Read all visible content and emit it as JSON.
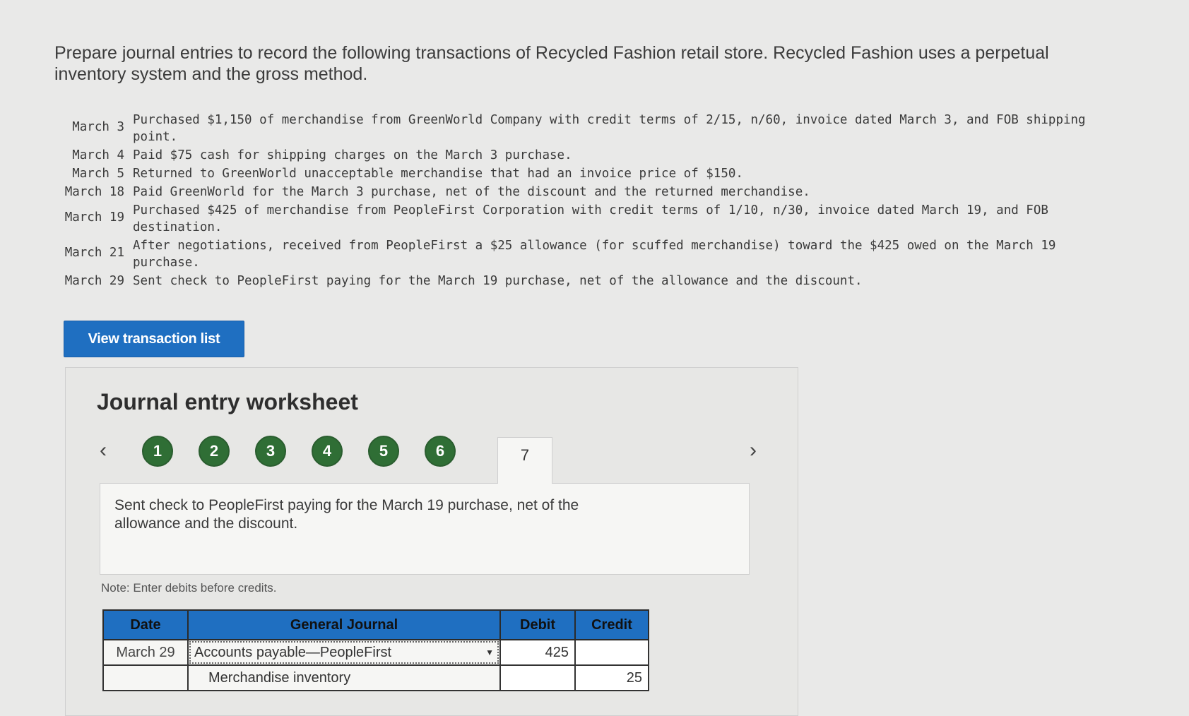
{
  "instructions": "Prepare journal entries to record the following transactions of Recycled Fashion retail store. Recycled Fashion uses a perpetual inventory system and the gross method.",
  "transactions": [
    {
      "date": "March 3",
      "text": "Purchased $1,150 of merchandise from GreenWorld Company with credit terms of 2/15, n/60, invoice dated March 3, and FOB shipping point."
    },
    {
      "date": "March 4",
      "text": "Paid $75 cash for shipping charges on the March 3 purchase."
    },
    {
      "date": "March 5",
      "text": "Returned to GreenWorld unacceptable merchandise that had an invoice price of $150."
    },
    {
      "date": "March 18",
      "text": "Paid GreenWorld for the March 3 purchase, net of the discount and the returned merchandise."
    },
    {
      "date": "March 19",
      "text": "Purchased $425 of merchandise from PeopleFirst Corporation with credit terms of 1/10, n/30, invoice dated March 19, and FOB destination."
    },
    {
      "date": "March 21",
      "text": "After negotiations, received from PeopleFirst a $25 allowance (for scuffed merchandise) toward the $425 owed on the March 19 purchase."
    },
    {
      "date": "March 29",
      "text": "Sent check to PeopleFirst paying for the March 19 purchase, net of the allowance and the discount."
    }
  ],
  "view_button": "View transaction list",
  "worksheet": {
    "title": "Journal entry worksheet",
    "steps": [
      "1",
      "2",
      "3",
      "4",
      "5",
      "6"
    ],
    "active_step": "7",
    "prev_icon": "‹",
    "next_icon": "›",
    "description": "Sent check to PeopleFirst paying for the March 19 purchase, net of the allowance and the discount.",
    "note": "Note: Enter debits before credits.",
    "table": {
      "headers": {
        "date": "Date",
        "journal": "General Journal",
        "debit": "Debit",
        "credit": "Credit"
      },
      "rows": [
        {
          "date": "March 29",
          "account": "Accounts payable—PeopleFirst",
          "debit": "425",
          "credit": ""
        },
        {
          "date": "",
          "account": "Merchandise inventory",
          "debit": "",
          "credit": "25"
        }
      ]
    }
  },
  "colors": {
    "primary_blue": "#1f6fc1",
    "step_green": "#2f6e35"
  }
}
